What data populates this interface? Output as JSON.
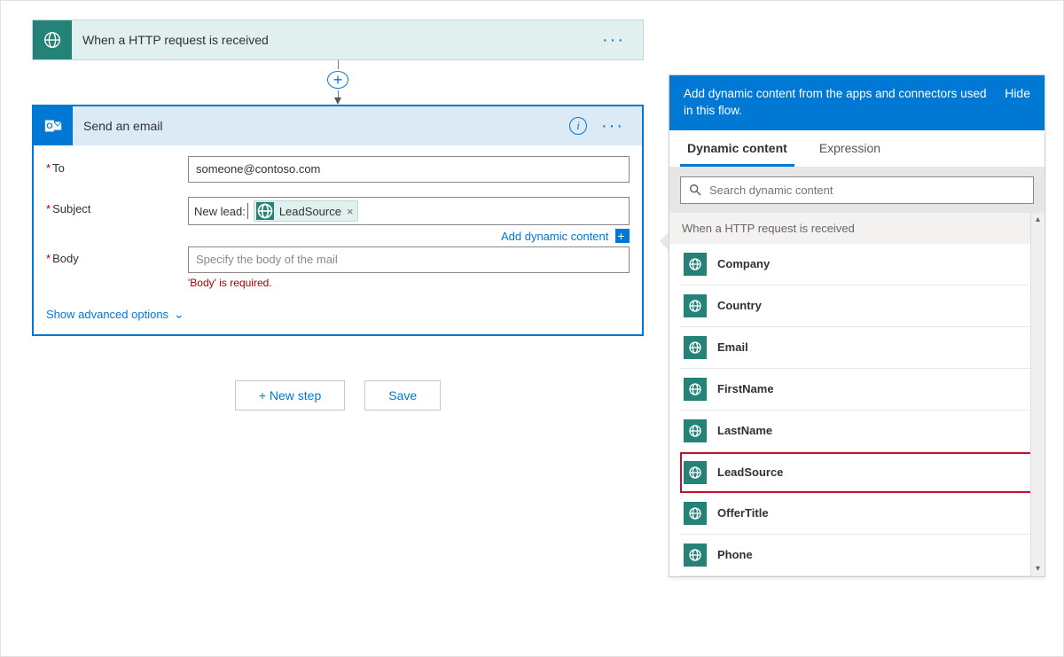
{
  "trigger": {
    "title": "When a HTTP request is received"
  },
  "action": {
    "title": "Send an email",
    "fields": {
      "to_label": "To",
      "to_value": "someone@contoso.com",
      "subject_label": "Subject",
      "subject_prefix": "New lead: ",
      "subject_token": "LeadSource",
      "body_label": "Body",
      "body_placeholder": "Specify the body of the mail",
      "body_error": "'Body' is required."
    },
    "add_dynamic_content": "Add dynamic content",
    "show_advanced": "Show advanced options"
  },
  "buttons": {
    "new_step": "+ New step",
    "save": "Save"
  },
  "dynamic_panel": {
    "header_text": "Add dynamic content from the apps and connectors used in this flow.",
    "hide": "Hide",
    "tabs": {
      "dynamic": "Dynamic content",
      "expression": "Expression"
    },
    "search_placeholder": "Search dynamic content",
    "group_header": "When a HTTP request is received",
    "items": [
      "Company",
      "Country",
      "Email",
      "FirstName",
      "LastName",
      "LeadSource",
      "OfferTitle",
      "Phone"
    ],
    "highlight_index": 5
  }
}
